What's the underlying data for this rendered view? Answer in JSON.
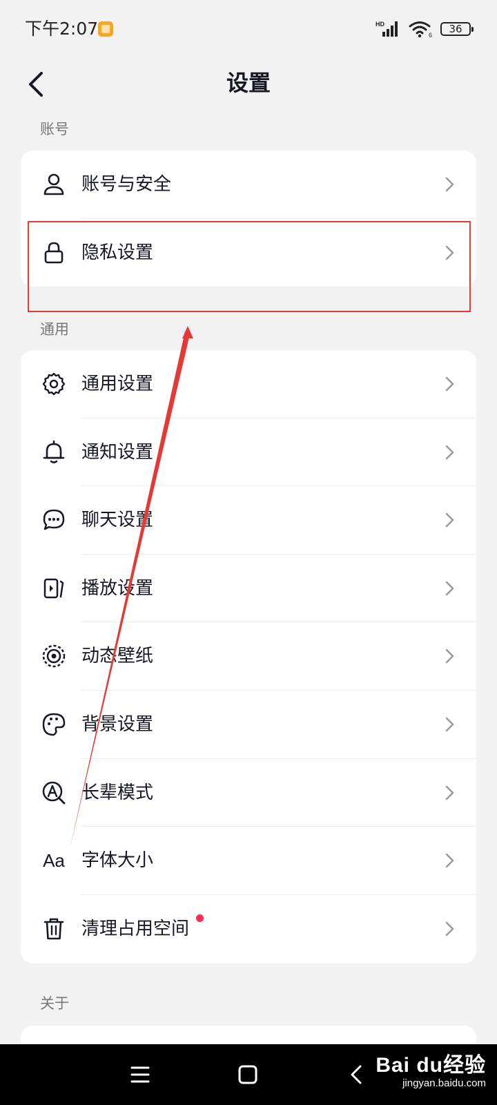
{
  "status_bar": {
    "time": "下午2:07",
    "network": "HD",
    "wifi_sub": "6",
    "battery": "36"
  },
  "header": {
    "title": "设置",
    "back_icon": "chevron-left-icon"
  },
  "sections": {
    "account": {
      "title": "账号",
      "items": [
        {
          "label": "账号与安全",
          "icon": "user-icon"
        },
        {
          "label": "隐私设置",
          "icon": "lock-icon"
        }
      ]
    },
    "general": {
      "title": "通用",
      "items": [
        {
          "label": "通用设置",
          "icon": "gear-icon"
        },
        {
          "label": "通知设置",
          "icon": "bell-icon"
        },
        {
          "label": "聊天设置",
          "icon": "chat-bubble-icon"
        },
        {
          "label": "播放设置",
          "icon": "play-icon"
        },
        {
          "label": "动态壁纸",
          "icon": "live-wallpaper-icon"
        },
        {
          "label": "背景设置",
          "icon": "palette-icon"
        },
        {
          "label": "长辈模式",
          "icon": "elder-mode-icon"
        },
        {
          "label": "字体大小",
          "icon": "font-size-icon",
          "icon_text": "Aa"
        },
        {
          "label": "清理占用空间",
          "icon": "trash-icon",
          "has_dot": true
        }
      ]
    },
    "about": {
      "title": "关于"
    }
  },
  "watermark": {
    "main": "Bai du经验",
    "sub": "jingyan.baidu.com"
  },
  "colors": {
    "background": "#f2f2f2",
    "card": "#ffffff",
    "text": "#161823",
    "highlight": "#e53935",
    "dot": "#fe2c55"
  }
}
